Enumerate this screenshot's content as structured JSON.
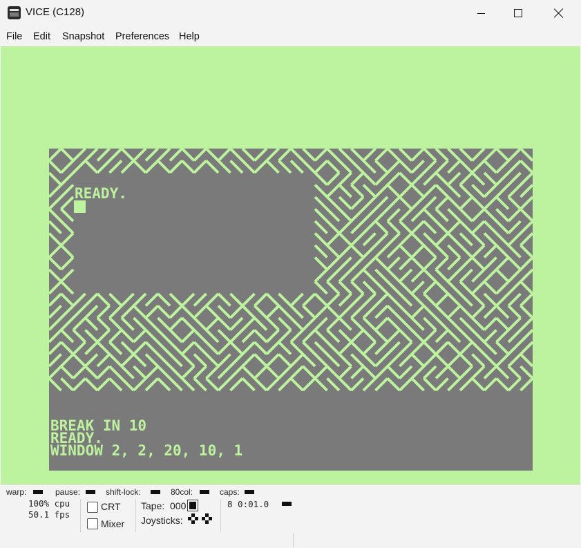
{
  "window": {
    "title": "VICE (C128)"
  },
  "menu": [
    "File",
    "Edit",
    "Snapshot",
    "Preferences",
    "Help"
  ],
  "screen": {
    "colors": {
      "background": "#7a7a7a",
      "border": "#bdf29e",
      "text": "#bdf29e"
    },
    "window_text": "READY.",
    "bottom_lines": [
      "BREAK IN 10",
      "READY.",
      "WINDOW 2, 2, 20, 10, 1"
    ]
  },
  "status": {
    "warp": "warp:",
    "pause": "pause:",
    "shift_lock": "shift-lock:",
    "col80": "80col:",
    "caps": "caps:",
    "cpu": "100% cpu",
    "fps": "50.1 fps",
    "crt": "CRT",
    "mixer": "Mixer",
    "tape_label": "Tape:",
    "tape_counter": "000",
    "joysticks": "Joysticks:",
    "drive": "8 0:01.0"
  }
}
